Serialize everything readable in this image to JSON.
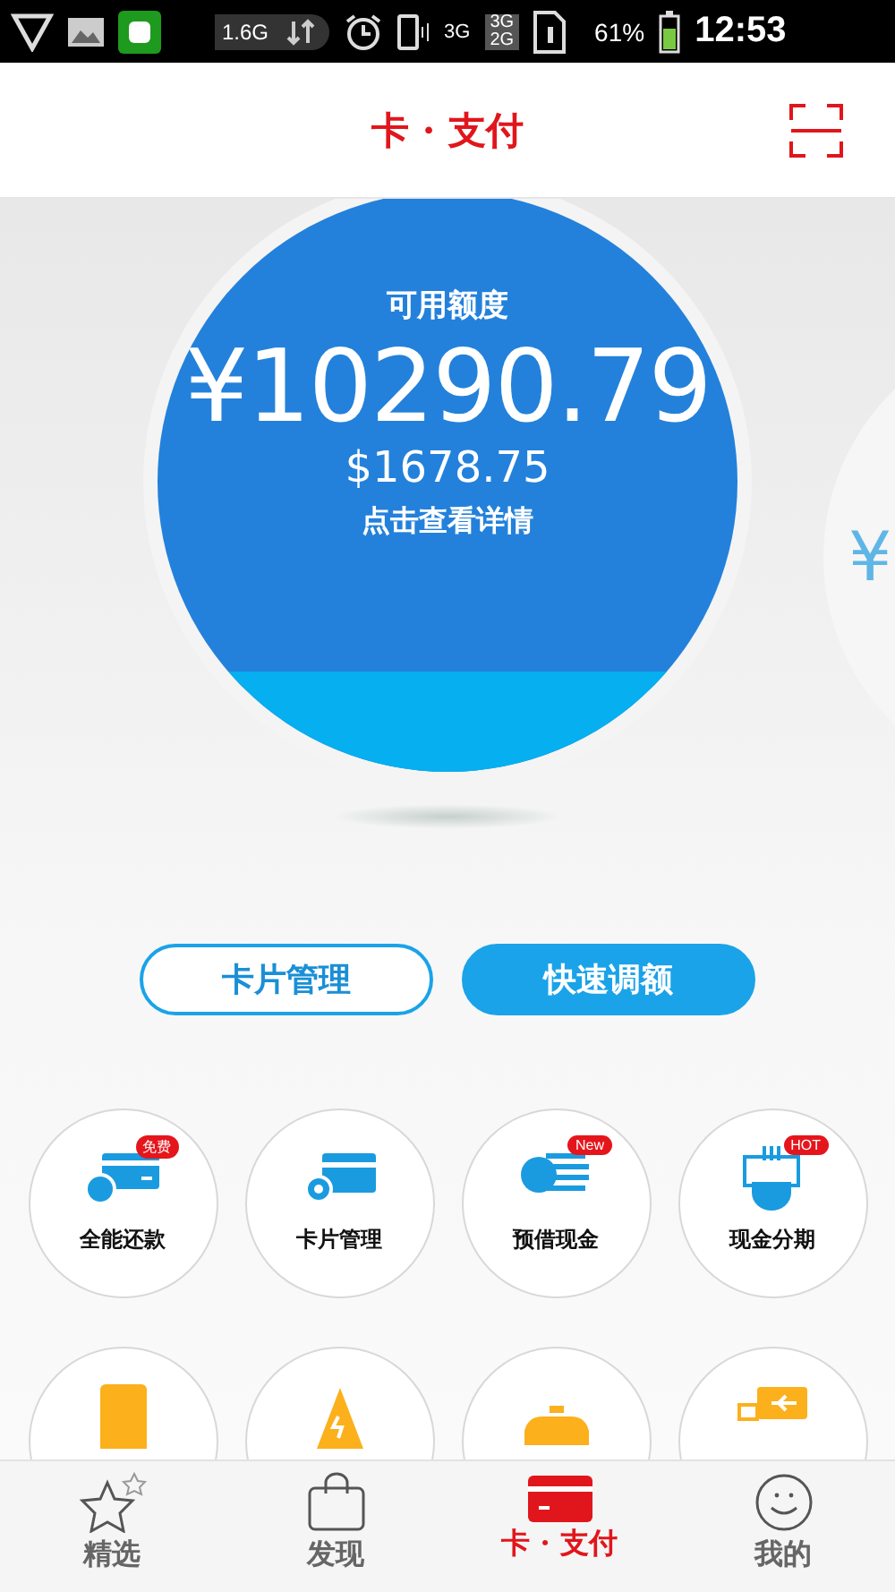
{
  "status_bar": {
    "data_usage": "1.6G",
    "network": "3G",
    "sim_1": "3G",
    "sim_2": "2G",
    "battery": "61%",
    "time": "12:53"
  },
  "header": {
    "title": "卡 · 支付"
  },
  "balance_card": {
    "label": "可用额度",
    "amount": "¥10290.79",
    "usd_amount": "$1678.75",
    "hint": "点击查看详情"
  },
  "next_card": {
    "amount_peek": "¥"
  },
  "actions": [
    {
      "label": "卡片管理",
      "kind": "outline"
    },
    {
      "label": "快速调额",
      "kind": "filled"
    }
  ],
  "services": [
    {
      "label": "全能还款",
      "kind": "repay",
      "badge": "免费"
    },
    {
      "label": "卡片管理",
      "kind": "card-settings"
    },
    {
      "label": "预借现金",
      "kind": "cash",
      "badge": "New"
    },
    {
      "label": "现金分期",
      "kind": "installment",
      "badge": "HOT"
    },
    {
      "kind": "phone"
    },
    {
      "kind": "power"
    },
    {
      "kind": "taxi"
    },
    {
      "kind": "flight"
    }
  ],
  "tabs": [
    {
      "label": "精选",
      "kind": "star",
      "selected": false
    },
    {
      "label": "发现",
      "kind": "bag",
      "selected": false
    },
    {
      "label": "卡 · 支付",
      "kind": "card",
      "selected": true
    },
    {
      "label": "我的",
      "kind": "smile",
      "selected": false
    }
  ]
}
